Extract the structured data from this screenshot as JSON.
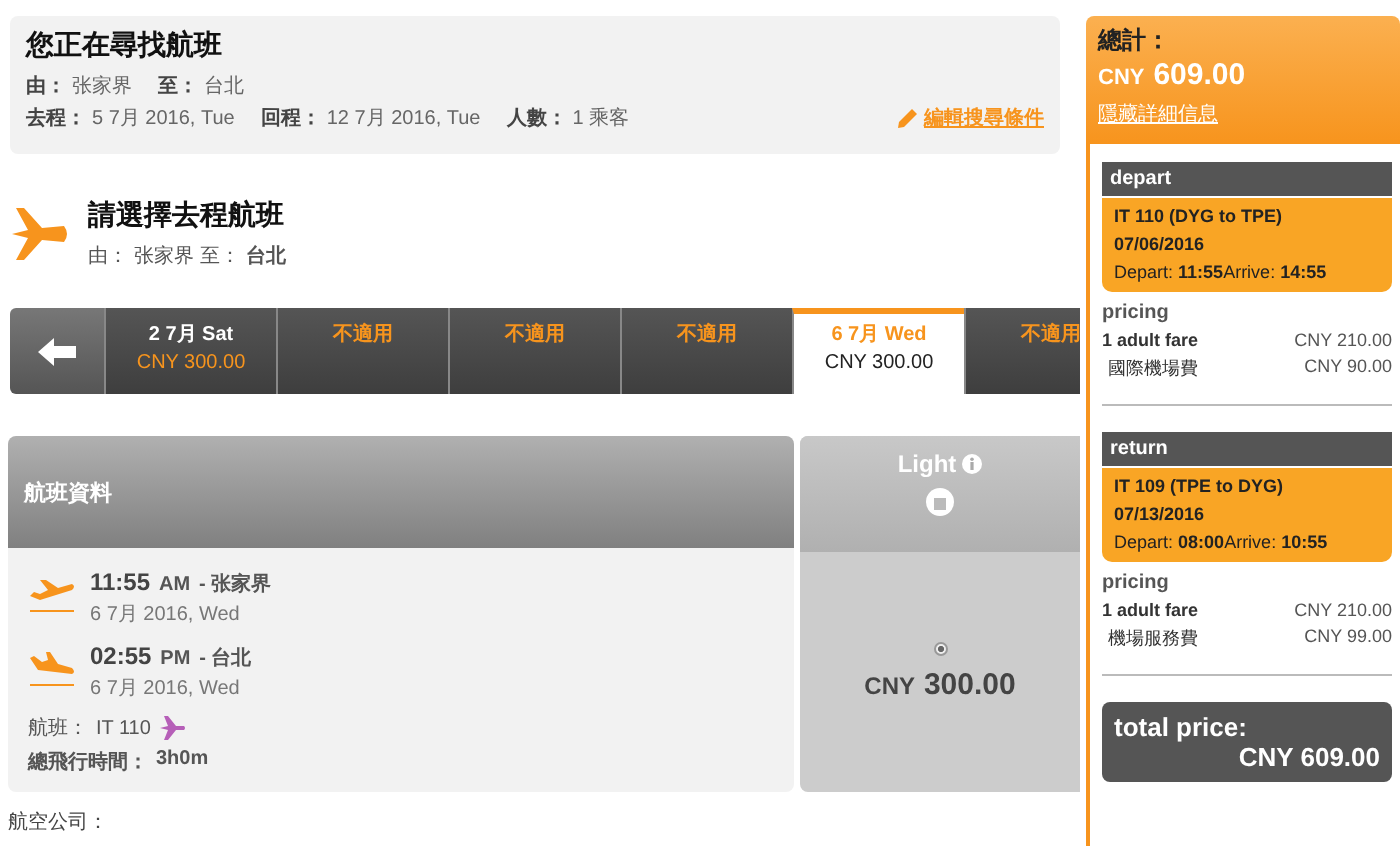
{
  "search_summary": {
    "title": "您正在尋找航班",
    "from_label": "由：",
    "from": "张家界",
    "to_label": "至：",
    "to": "台北",
    "depart_label": "去程：",
    "depart": "5 7月 2016, Tue",
    "return_label": "回程：",
    "return": "12 7月 2016, Tue",
    "pax_label": "人數：",
    "pax": "1 乘客",
    "edit_link": "編輯搜尋條件"
  },
  "section": {
    "title": "請選擇去程航班",
    "from_label": "由：",
    "from": "张家界",
    "to_label": "至：",
    "to": "台北"
  },
  "date_tabs": [
    {
      "date": "2 7月 Sat",
      "price": "CNY 300.00",
      "selected": false
    },
    {
      "date": "不適用",
      "selected": false
    },
    {
      "date": "不適用",
      "selected": false
    },
    {
      "date": "不適用",
      "selected": false
    },
    {
      "date": "6 7月 Wed",
      "price": "CNY 300.00",
      "selected": true
    },
    {
      "date": "不適用",
      "selected": false
    }
  ],
  "flight": {
    "header": "航班資料",
    "fare_name": "Light",
    "segments": [
      {
        "kind": "takeoff",
        "time": "11:55",
        "ampm": "AM",
        "city": "- 张家界",
        "date": "6 7月 2016, Wed"
      },
      {
        "kind": "landing",
        "time": "02:55",
        "ampm": "PM",
        "city": "- 台北",
        "date": "6 7月 2016, Wed"
      }
    ],
    "flight_label": "航班：",
    "flight_no": "IT 110",
    "duration_label": "總飛行時間：",
    "duration": "3h0m",
    "fare_selected": true,
    "fare_currency": "CNY",
    "fare_price": "300.00"
  },
  "airlines_label": "航空公司：",
  "sidebar": {
    "total_label": "總計：",
    "total_currency": "CNY",
    "total": "609.00",
    "hide_link": "隱藏詳細信息",
    "legs": [
      {
        "heading": "depart",
        "route": "IT 110 (DYG to TPE)",
        "date": "07/06/2016",
        "depart_label": "Depart:",
        "depart": "11:55",
        "arrive_label": "Arrive:",
        "arrive": "14:55",
        "pricing": "pricing",
        "items": [
          {
            "name": "1 adult fare",
            "amount": "CNY 210.00"
          },
          {
            "name": "國際機場費",
            "amount": "CNY 90.00"
          }
        ]
      },
      {
        "heading": "return",
        "route": "IT 109 (TPE to DYG)",
        "date": "07/13/2016",
        "depart_label": "Depart:",
        "depart": "08:00",
        "arrive_label": "Arrive:",
        "arrive": "10:55",
        "pricing": "pricing",
        "items": [
          {
            "name": "1 adult fare",
            "amount": "CNY 210.00"
          },
          {
            "name": "機場服務費",
            "amount": "CNY 99.00"
          }
        ]
      }
    ],
    "total_price_label": "total price:",
    "total_price": "CNY 609.00"
  }
}
